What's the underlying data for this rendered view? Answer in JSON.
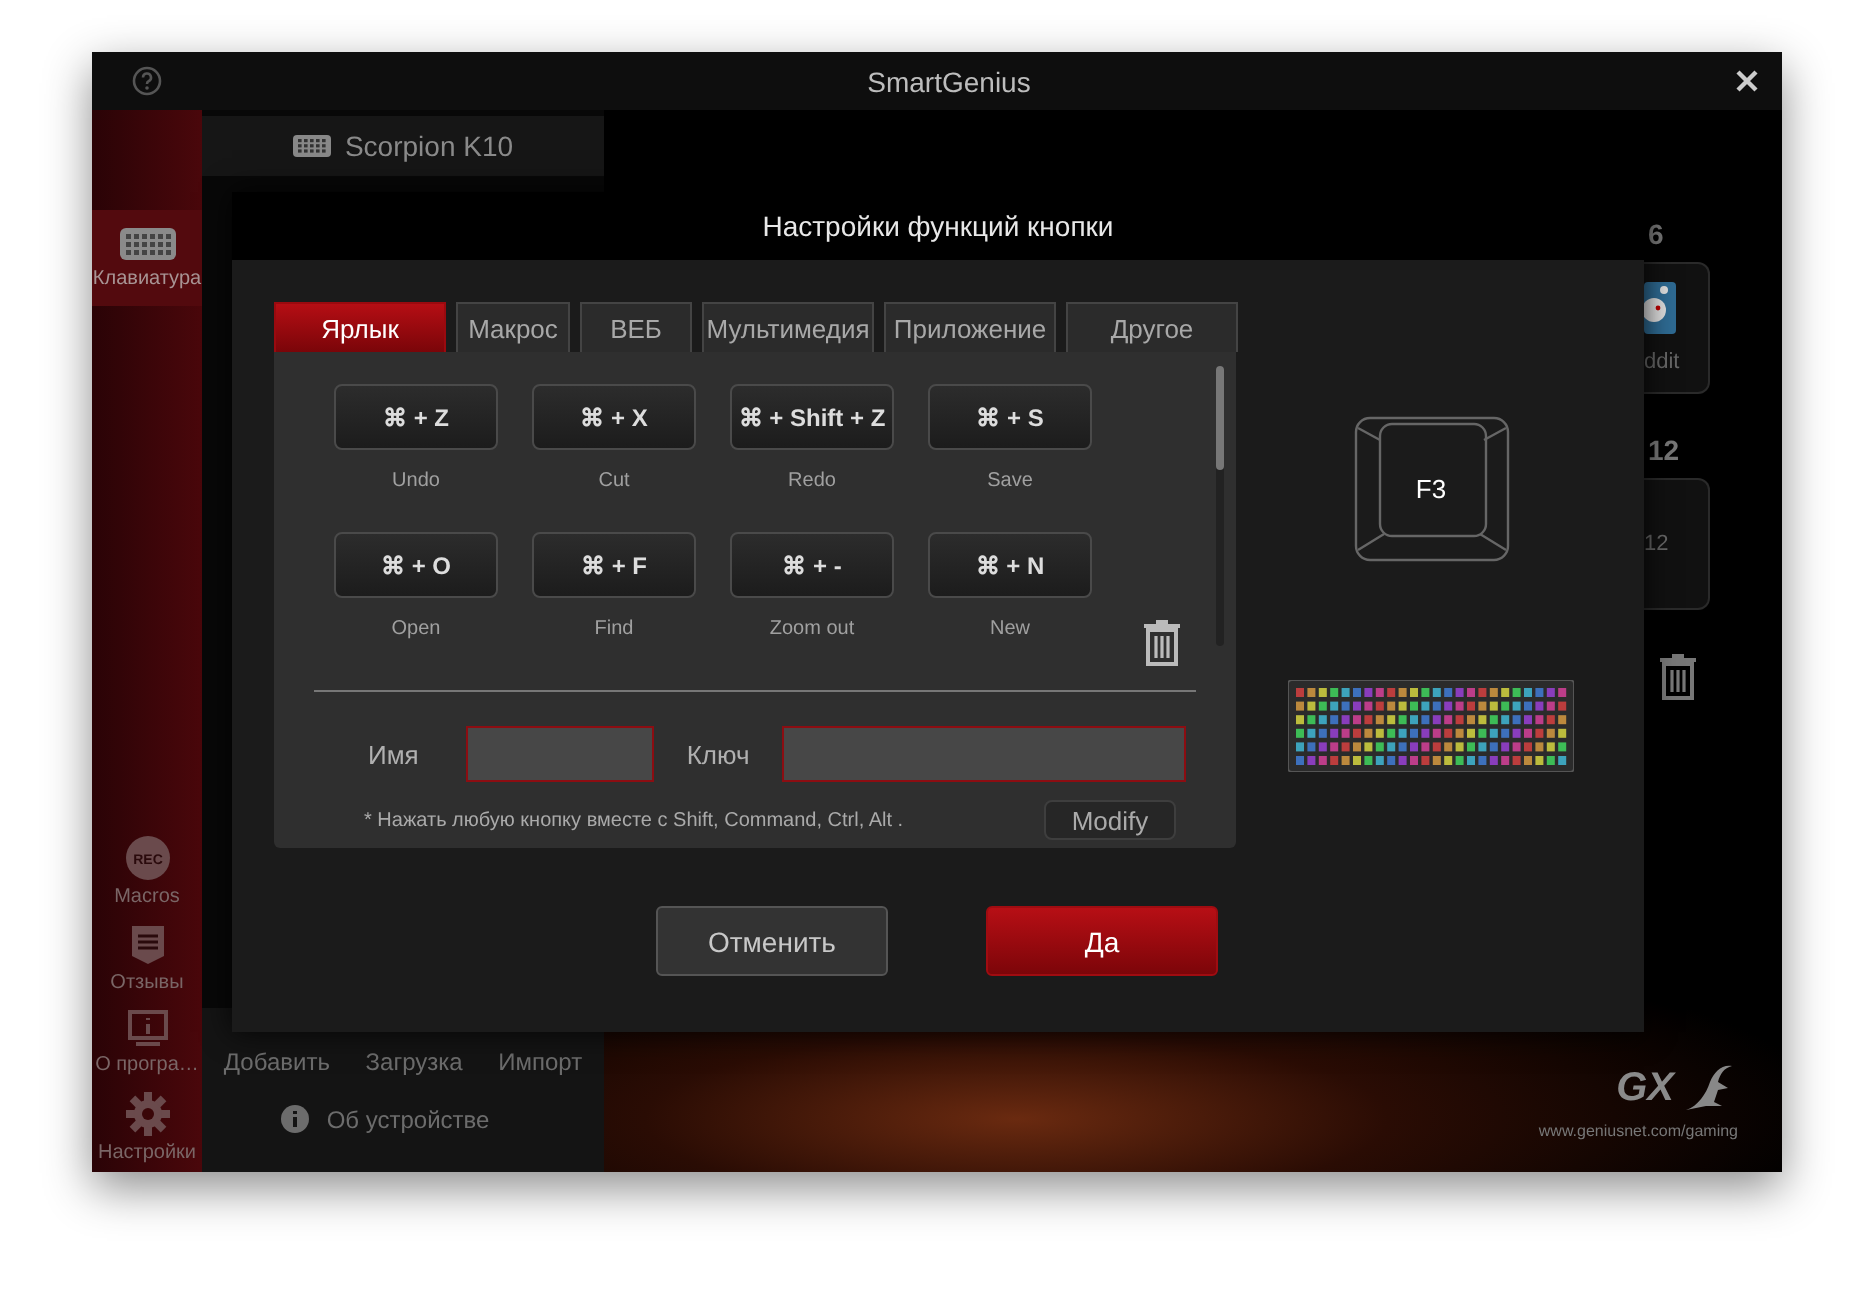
{
  "window": {
    "title": "SmartGenius"
  },
  "sidebar": {
    "items": [
      {
        "kind": "keyboard",
        "label": "Клавиатура",
        "selected": true
      },
      {
        "kind": "rec",
        "label": "Macros",
        "icon_text": "REC",
        "selected": false
      },
      {
        "kind": "review",
        "label": "Отзывы",
        "selected": false
      },
      {
        "kind": "about",
        "label": "О програ…",
        "selected": false
      },
      {
        "kind": "settings",
        "label": "Настройки",
        "selected": false
      }
    ]
  },
  "device": {
    "name": "Scorpion K10"
  },
  "bottom_actions": [
    "Добавить",
    "Загрузка",
    "Импорт"
  ],
  "device_info": "Об устройстве",
  "key_slots": [
    {
      "number": "6",
      "kind": "app",
      "label": "ddit"
    },
    {
      "number": "12",
      "kind": "key",
      "label": "12"
    }
  ],
  "logo": {
    "text": "GX",
    "url": "www.geniusnet.com/gaming"
  },
  "dialog": {
    "title": "Настройки функций кнопки",
    "tabs": [
      {
        "label": "Ярлык",
        "selected": true
      },
      {
        "label": "Макрос",
        "selected": false
      },
      {
        "label": "ВЕБ",
        "selected": false
      },
      {
        "label": "Мультимедия",
        "selected": false
      },
      {
        "label": "Приложение",
        "selected": false
      },
      {
        "label": "Другое",
        "selected": false
      }
    ],
    "shortcuts": [
      {
        "keys": "⌘ + Z",
        "label": "Undo"
      },
      {
        "keys": "⌘ + X",
        "label": "Cut"
      },
      {
        "keys": "⌘ + Shift + Z",
        "label": "Redo"
      },
      {
        "keys": "⌘ + S",
        "label": "Save"
      },
      {
        "keys": "⌘ + O",
        "label": "Open"
      },
      {
        "keys": "⌘ + F",
        "label": "Find"
      },
      {
        "keys": "⌘ + -",
        "label": "Zoom out"
      },
      {
        "keys": "⌘ + N",
        "label": "New"
      }
    ],
    "name_label": "Имя",
    "key_label": "Ключ",
    "note": "* Нажать любую кнопку вместе с Shift, Command, Ctrl, Alt .",
    "modify_button": "Modify",
    "cancel_button": "Отменить",
    "ok_button": "Да",
    "key_preview": "F3"
  }
}
